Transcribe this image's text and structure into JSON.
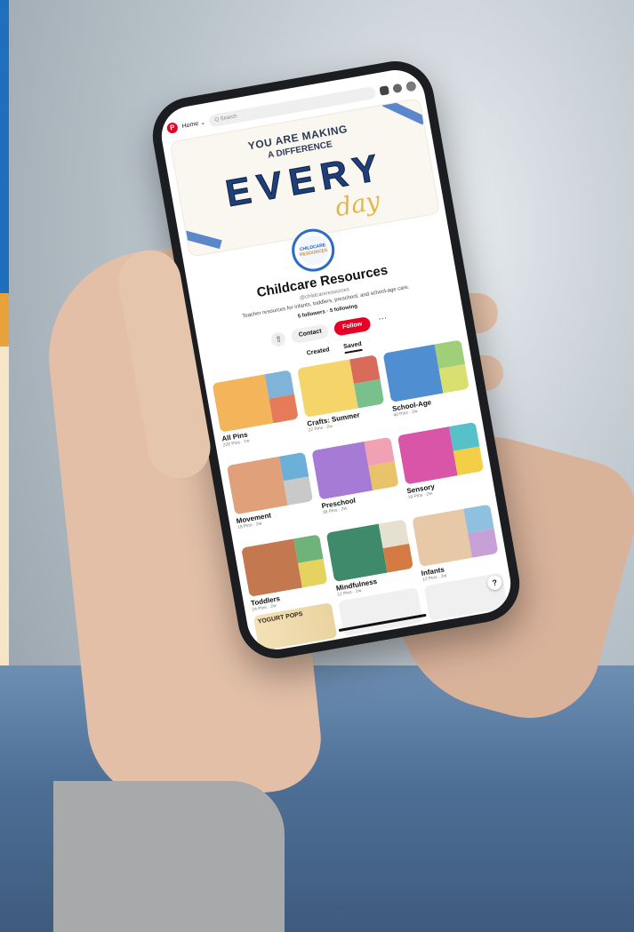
{
  "header": {
    "logo_letter": "P",
    "home_label": "Home ⌄",
    "search_placeholder": "Q  Search"
  },
  "banner": {
    "line1": "YOU ARE MAKING",
    "line2": "A DIFFERENCE",
    "line3": "EVERY",
    "line4": "day"
  },
  "profile": {
    "avatar_text_1": "CHILDCARE",
    "avatar_text_2": "RESOURCES",
    "name": "Childcare Resources",
    "handle": "@childcareresources",
    "bio": "Teacher resources for infants, toddlers, preschool, and school-age care.",
    "follows": "5 followers · 5 following",
    "contact_label": "Contact",
    "follow_label": "Follow",
    "more_label": "···",
    "share_glyph": "⇧"
  },
  "tabs": {
    "created": "Created",
    "saved": "Saved"
  },
  "boards": [
    {
      "name": "All Pins",
      "meta": "228 Pins · 1w"
    },
    {
      "name": "Crafts: Summer",
      "meta": "22 Pins · 2w"
    },
    {
      "name": "School-Age",
      "meta": "40 Pins · 2w"
    },
    {
      "name": "Movement",
      "meta": "18 Pins · 2w"
    },
    {
      "name": "Preschool",
      "meta": "38 Pins · 2w"
    },
    {
      "name": "Sensory",
      "meta": "19 Pins · 2w"
    },
    {
      "name": "Toddlers",
      "meta": "24 Pins · 2w"
    },
    {
      "name": "Mindfulness",
      "meta": "12 Pins · 2w"
    },
    {
      "name": "Infants",
      "meta": "12 Pins · 2w"
    }
  ],
  "last_row": {
    "first_text": "YOGURT POPS"
  },
  "help_label": "?",
  "colors": {
    "pinterest_red": "#e60023",
    "brand_blue": "#2b6cc4"
  }
}
